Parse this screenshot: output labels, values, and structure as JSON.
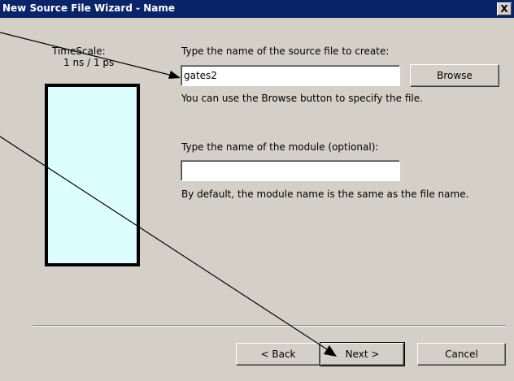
{
  "window": {
    "title": "New Source File Wizard - Name",
    "close_glyph": "X"
  },
  "left_panel": {
    "timescale_label": "TimeScale:",
    "timescale_value": "1 ns / 1 ps"
  },
  "file_section": {
    "label": "Type the name of the source file to create:",
    "value": "gates2",
    "browse_label": "Browse",
    "hint": "You can use the Browse button to specify the file."
  },
  "module_section": {
    "label": "Type the name of the module (optional):",
    "value": "",
    "hint": "By default, the module name is the same as the file name."
  },
  "footer": {
    "back_label": "< Back",
    "next_label": "Next >",
    "cancel_label": "Cancel"
  },
  "icons": {
    "close": "close-icon"
  }
}
